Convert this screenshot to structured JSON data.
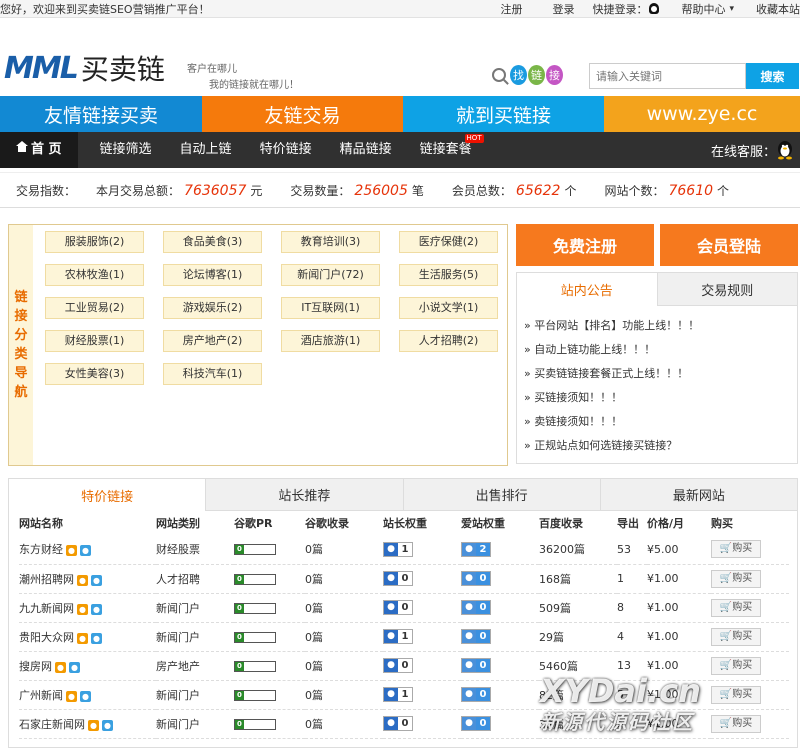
{
  "topbar": {
    "welcome": "您好，欢迎来到买卖链SEO营销推广平台！",
    "register": "注册",
    "login": "登录",
    "quick_login": "快捷登录：",
    "help": "帮助中心",
    "help_arrow": "▾",
    "favorite": "收藏本站"
  },
  "header": {
    "logo_latin": "MML",
    "logo_cn": "买卖链",
    "slogan_1": "客户在哪儿",
    "slogan_2": "我的链接就在哪儿！",
    "findlink": [
      "找",
      "链",
      "接"
    ],
    "search_placeholder": "请输入关键词",
    "search_button": "搜索"
  },
  "banner": [
    {
      "text": "友情链接买卖",
      "color": "#1289d3"
    },
    {
      "text": "友链交易",
      "color": "#f57a0c"
    },
    {
      "text": "就到买链接",
      "color": "#0ea2e5"
    },
    {
      "text": "www.zye.cc",
      "color": "#f3a31c"
    }
  ],
  "nav": {
    "items": [
      "首 页",
      "链接筛选",
      "自动上链",
      "特价链接",
      "精品链接",
      "链接套餐"
    ],
    "hot": "HOT",
    "service": "在线客服："
  },
  "stats": {
    "label": "交易指数：",
    "total_label": "本月交易总额：",
    "total": "7636057",
    "total_unit": "元",
    "count_label": "交易数量：",
    "count": "256005",
    "count_unit": "笔",
    "members_label": "会员总数：",
    "members": "65622",
    "members_unit": "个",
    "sites_label": "网站个数：",
    "sites": "76610",
    "sites_unit": "个"
  },
  "categories": {
    "label": [
      "链",
      "接",
      "分",
      "类",
      "导",
      "航"
    ],
    "items": [
      "服装服饰(2)",
      "食品美食(3)",
      "教育培训(3)",
      "医疗保健(2)",
      "农林牧渔(1)",
      "论坛博客(1)",
      "新闻门户(72)",
      "生活服务(5)",
      "工业贸易(2)",
      "游戏娱乐(2)",
      "IT互联网(1)",
      "小说文学(1)",
      "财经股票(1)",
      "房产地产(2)",
      "酒店旅游(1)",
      "人才招聘(2)",
      "女性美容(3)",
      "科技汽车(1)"
    ]
  },
  "account": {
    "register": "免费注册",
    "login": "会员登陆"
  },
  "notice": {
    "tabs": [
      "站内公告",
      "交易规则"
    ],
    "items": [
      "» 平台网站【排名】功能上线！！！",
      "» 自动上链功能上线！！！",
      "» 买卖链链接套餐正式上线！！！",
      "» 买链接须知！！！",
      "» 卖链接须知！！！",
      "» 正规站点如何选链接买链接？"
    ]
  },
  "listing": {
    "tabs": [
      "特价链接",
      "站长推荐",
      "出售排行",
      "最新网站"
    ],
    "headers": [
      "网站名称",
      "网站类别",
      "谷歌PR",
      "谷歌收录",
      "站长权重",
      "爱站权重",
      "百度收录",
      "导出",
      "价格/月",
      "购买"
    ],
    "buy_label": "购买",
    "rows": [
      {
        "name": "东方财经",
        "cat": "财经股票",
        "pr": "0",
        "google": "0篇",
        "zz": "1",
        "az": "2",
        "baidu": "36200篇",
        "out": "53",
        "price": "¥5.00"
      },
      {
        "name": "潮州招聘网",
        "cat": "人才招聘",
        "pr": "0",
        "google": "0篇",
        "zz": "0",
        "az": "0",
        "baidu": "168篇",
        "out": "1",
        "price": "¥1.00"
      },
      {
        "name": "九九新闻网",
        "cat": "新闻门户",
        "pr": "0",
        "google": "0篇",
        "zz": "0",
        "az": "0",
        "baidu": "509篇",
        "out": "8",
        "price": "¥1.00"
      },
      {
        "name": "贵阳大众网",
        "cat": "新闻门户",
        "pr": "0",
        "google": "0篇",
        "zz": "1",
        "az": "0",
        "baidu": "29篇",
        "out": "4",
        "price": "¥1.00"
      },
      {
        "name": "搜房网",
        "cat": "房产地产",
        "pr": "0",
        "google": "0篇",
        "zz": "0",
        "az": "0",
        "baidu": "5460篇",
        "out": "13",
        "price": "¥1.00"
      },
      {
        "name": "广州新闻",
        "cat": "新闻门户",
        "pr": "0",
        "google": "0篇",
        "zz": "1",
        "az": "0",
        "baidu": "82篇",
        "out": "5",
        "price": "¥1.00"
      },
      {
        "name": "石家庄新闻网",
        "cat": "新闻门户",
        "pr": "0",
        "google": "0篇",
        "zz": "0",
        "az": "0",
        "baidu": "32篇",
        "out": "5",
        "price": "¥1.00"
      }
    ]
  },
  "watermark": {
    "line1": "XYDai.cn",
    "line2": "新源代源码社区"
  },
  "colors": {
    "accent": "#f6791e",
    "nav_bg": "#303030",
    "highlight": "#e6340a"
  }
}
